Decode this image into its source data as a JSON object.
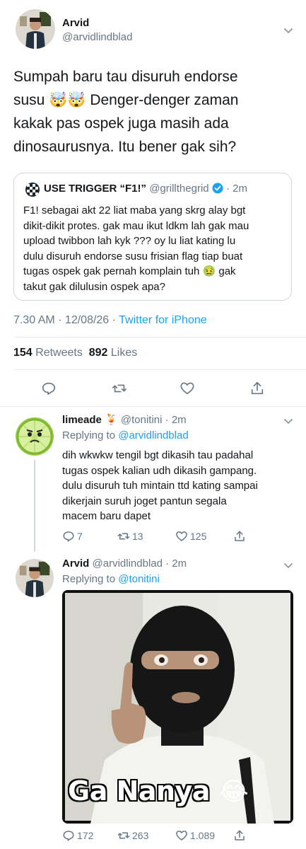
{
  "main_tweet": {
    "author_name": "Arvid",
    "author_handle": "@arvidlindblad",
    "text_part1": "Sumpah baru tau disuruh endorse",
    "text_part2_prefix": "susu ",
    "text_part2_emoji": "🤯🤯",
    "text_part2_suffix": " Denger-denger zaman",
    "text_line3": "kakak pas ospek juga masih ada",
    "text_line4": "dinosaurusnya. Itu bener gak sih?",
    "timestamp": "7.30 AM · 12/08/26 · ",
    "source": "Twitter for iPhone",
    "retweets_count": "154",
    "retweets_label": "Retweets",
    "likes_count": "892",
    "likes_label": "Likes"
  },
  "quoted_tweet": {
    "author_name": "USE TRIGGER “F1!”",
    "author_handle": "@grillthegrid",
    "time": "· 2m",
    "line1": "F1! sebagai akt 22 liat maba yang skrg alay bgt",
    "line2": "dikit-dikit protes. gak mau ikut ldkm lah gak mau",
    "line3": "upload twibbon lah kyk ??? oy lu liat kating lu",
    "line4": "dulu disuruh endorse susu frisian flag tiap buat",
    "line5_prefix": "tugas ospek gak pernah komplain tuh ",
    "line5_emoji": "🤢",
    "line5_suffix": " gak",
    "line6": "takut gak dilulusin ospek apa?"
  },
  "reply1": {
    "author_name": "limeade ",
    "author_emoji": "🍹",
    "author_handle": "@tonitini",
    "time": "· 2m",
    "replying_label": "Replying to ",
    "replying_to": "@arvidlindblad",
    "line1": "dih wkwkw tengil bgt dikasih tau padahal",
    "line2": "tugas ospek kalian udh dikasih gampang.",
    "line3": "dulu disuruh tuh mintain ttd kating sampai",
    "line4": "dikerjain suruh joget pantun segala",
    "line5": "macem baru dapet",
    "replies": "7",
    "retweets": "13",
    "likes": "125"
  },
  "reply2": {
    "author_name": "Arvid",
    "author_handle": "@arvidlindblad",
    "time": "· 2m",
    "replying_label": "Replying to ",
    "replying_to": "@tonitini",
    "meme_caption": "Ga Nanya",
    "meme_emoji": "😂",
    "replies": "172",
    "retweets": "263",
    "likes": "1.089"
  },
  "colors": {
    "accent": "#1da1f2",
    "text": "#14171a",
    "muted": "#657786",
    "divider": "#e6ecf0",
    "verified": "#1da1f2"
  },
  "icons": [
    "chevron-down-icon",
    "reply-icon",
    "retweet-icon",
    "like-icon",
    "share-icon",
    "verified-badge-icon"
  ]
}
